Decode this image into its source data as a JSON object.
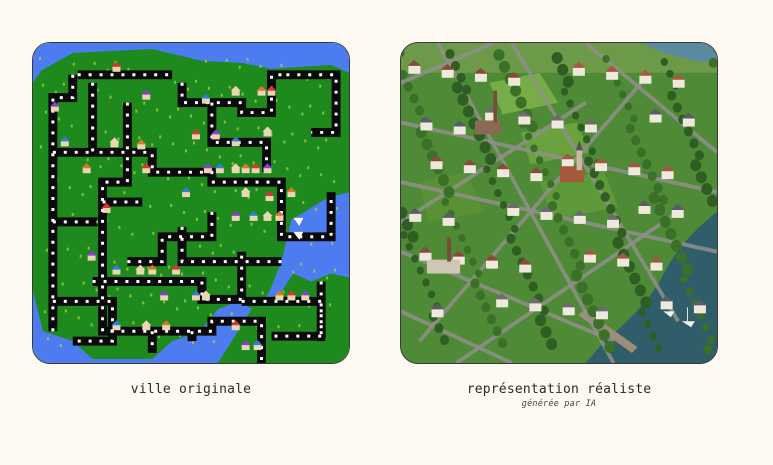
{
  "left": {
    "caption": "ville originale"
  },
  "right": {
    "caption": "représentation réaliste",
    "subcaption": "générée par IA"
  },
  "colors": {
    "water_pixel": "#4d7cf0",
    "grass_pixel": "#1e8a1e",
    "road_pixel": "#0a0a0a",
    "water_real": "#2f5d6a",
    "grass_real": "#4f8a36",
    "road_real": "#8f8f8a",
    "background": "#fdf8f0"
  }
}
